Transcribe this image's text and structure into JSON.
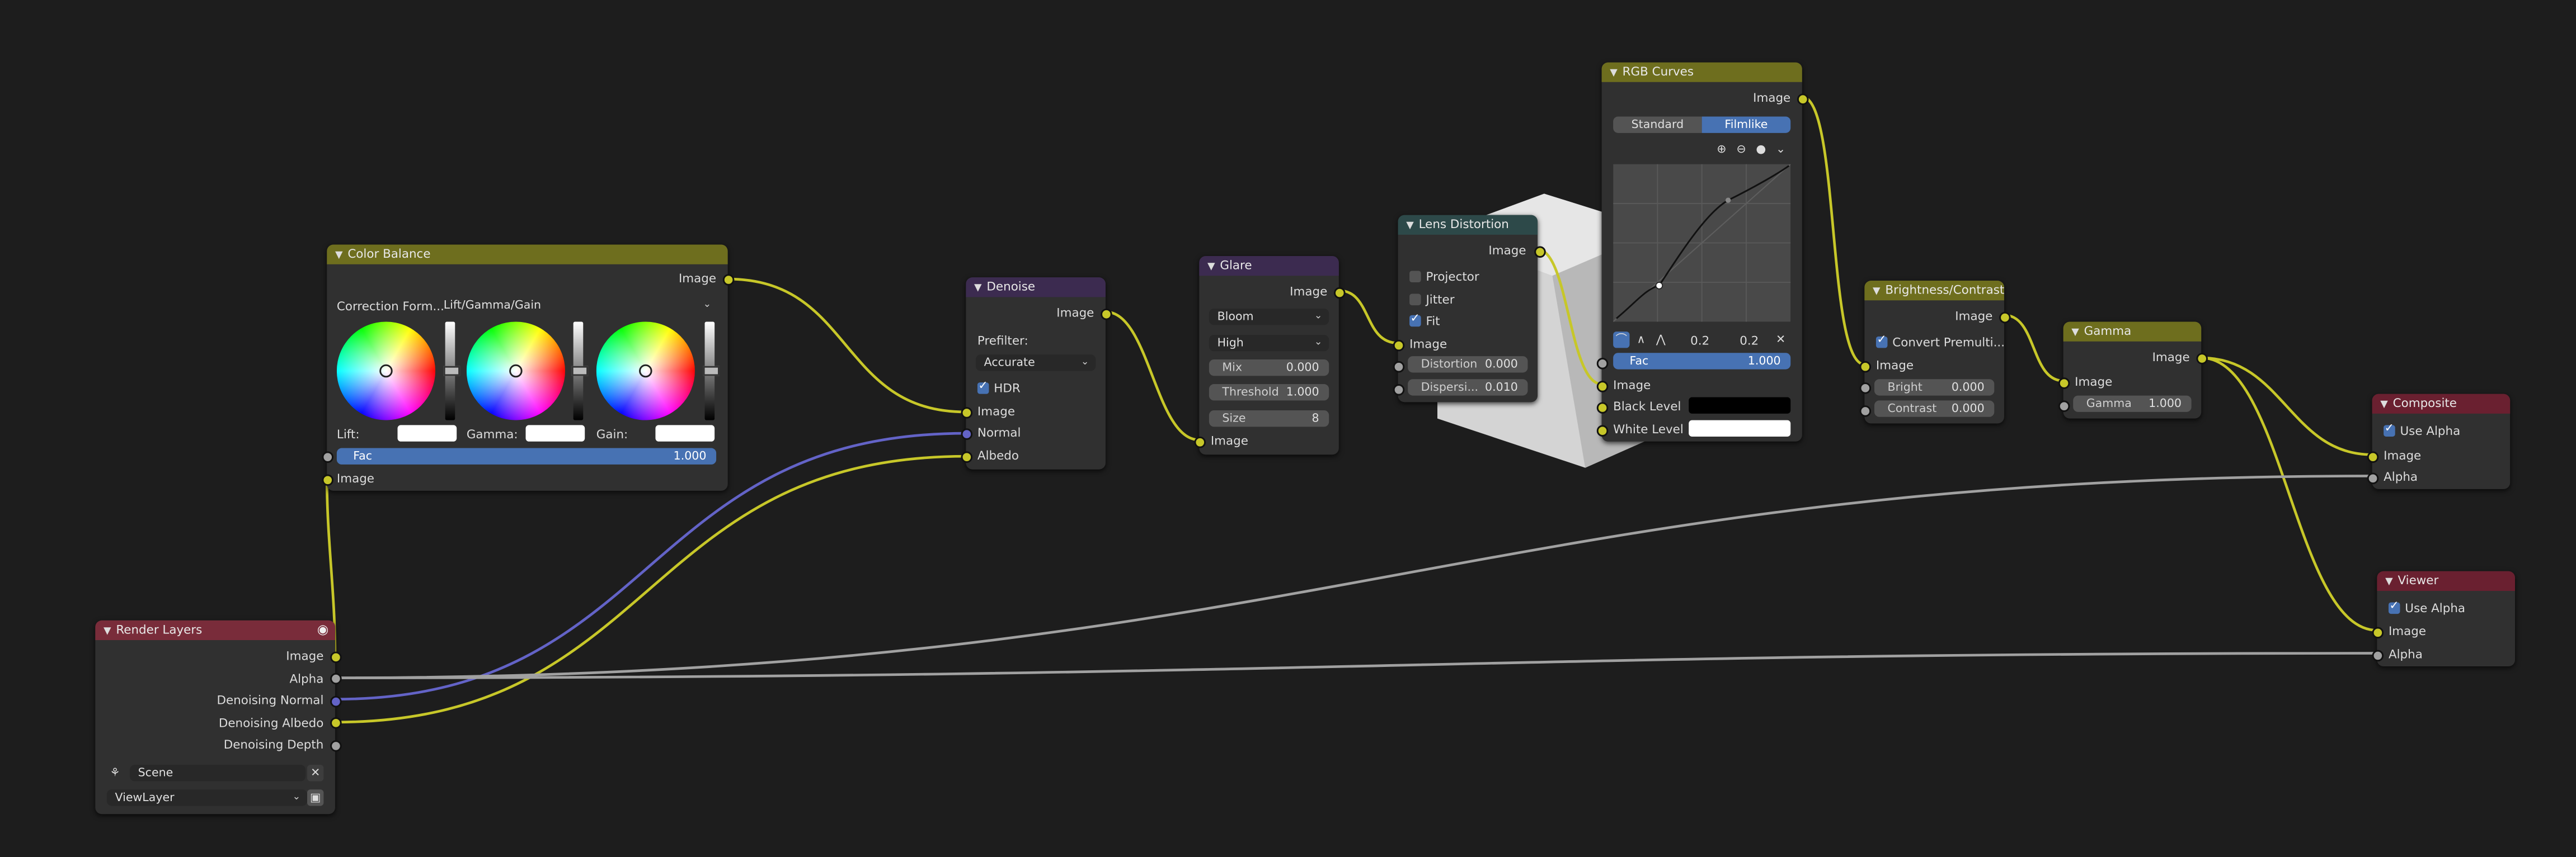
{
  "colors": {
    "socket_color": "#c7c729",
    "socket_float": "#a1a1a1",
    "socket_vector": "#6363c7",
    "header_color": "#6e6e1e",
    "header_filter": "#3c2b50",
    "header_distort": "#2d4949",
    "header_input": "#792c3a",
    "header_output": "#6a2030",
    "accent": "#4772b3"
  },
  "render_layers": {
    "title": "Render Layers",
    "outputs": [
      "Image",
      "Alpha",
      "Denoising Normal",
      "Denoising Albedo",
      "Denoising Depth"
    ],
    "scene": "Scene",
    "view_layer": "ViewLayer"
  },
  "color_balance": {
    "title": "Color Balance",
    "output": "Image",
    "correction_label": "Correction Form...",
    "correction_value": "Lift/Gamma/Gain",
    "lift_label": "Lift:",
    "gamma_label": "Gamma:",
    "gain_label": "Gain:",
    "fac_label": "Fac",
    "fac_value": "1.000",
    "input_image": "Image"
  },
  "denoise": {
    "title": "Denoise",
    "output": "Image",
    "prefilter_label": "Prefilter:",
    "prefilter_value": "Accurate",
    "hdr_label": "HDR",
    "inputs": [
      "Image",
      "Normal",
      "Albedo"
    ]
  },
  "glare": {
    "title": "Glare",
    "output": "Image",
    "type": "Bloom",
    "quality": "High",
    "mix_label": "Mix",
    "mix_value": "0.000",
    "threshold_label": "Threshold",
    "threshold_value": "1.000",
    "size_label": "Size",
    "size_value": "8",
    "input": "Image"
  },
  "lens_distortion": {
    "title": "Lens Distortion",
    "output": "Image",
    "projector_label": "Projector",
    "jitter_label": "Jitter",
    "fit_label": "Fit",
    "input": "Image",
    "distortion_label": "Distortion",
    "distortion_value": "0.000",
    "dispersion_label": "Dispersi...",
    "dispersion_value": "0.010"
  },
  "rgb_curves": {
    "title": "RGB Curves",
    "output": "Image",
    "tab_standard": "Standard",
    "tab_filmlike": "Filmlike",
    "x_value": "0.2",
    "y_value": "0.2",
    "fac_label": "Fac",
    "fac_value": "1.000",
    "input_image": "Image",
    "black_level": "Black Level",
    "white_level": "White Level"
  },
  "brightness_contrast": {
    "title": "Brightness/Contrast",
    "output": "Image",
    "premult_label": "Convert Premulti...",
    "input": "Image",
    "bright_label": "Bright",
    "bright_value": "0.000",
    "contrast_label": "Contrast",
    "contrast_value": "0.000"
  },
  "gamma": {
    "title": "Gamma",
    "output": "Image",
    "input": "Image",
    "gamma_label": "Gamma",
    "gamma_value": "1.000"
  },
  "composite": {
    "title": "Composite",
    "use_alpha": "Use Alpha",
    "image": "Image",
    "alpha": "Alpha"
  },
  "viewer": {
    "title": "Viewer",
    "use_alpha": "Use Alpha",
    "image": "Image",
    "alpha": "Alpha"
  }
}
